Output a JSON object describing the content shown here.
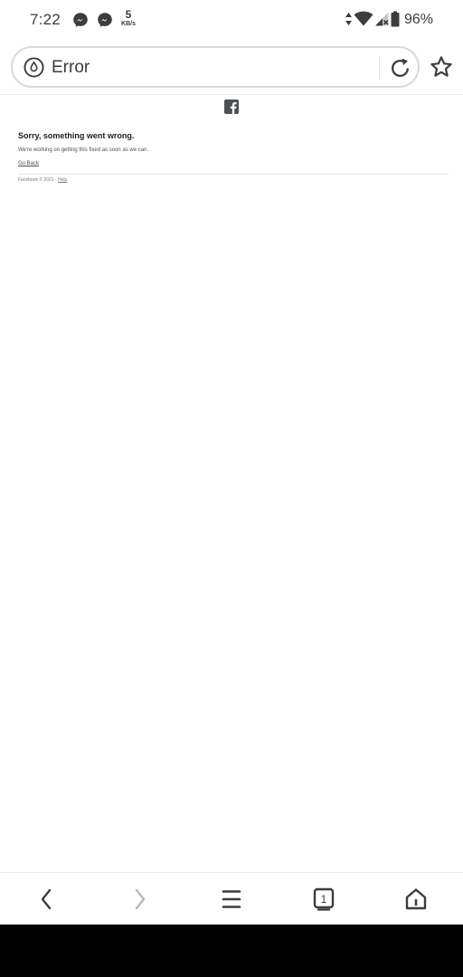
{
  "status_bar": {
    "time": "7:22",
    "net_speed_value": "5",
    "net_speed_unit": "KB/s",
    "battery_percent": "96%"
  },
  "address_bar": {
    "title": "Error"
  },
  "page": {
    "error_title": "Sorry, something went wrong.",
    "error_message": "We're working on getting this fixed as soon as we can.",
    "go_back_link": "Go Back",
    "footer_text": "Facebook © 2021 · ",
    "footer_help_link": "Help"
  },
  "icons": {
    "messenger": "messenger-icon",
    "wifi": "wifi-icon",
    "signal": "signal-icon",
    "battery": "battery-icon",
    "site": "site-info-icon",
    "reload": "reload-icon",
    "bookmark": "star-icon",
    "facebook": "facebook-logo-icon",
    "back": "chevron-left-icon",
    "forward": "chevron-right-icon",
    "menu": "menu-icon",
    "tabs": "tabs-icon",
    "home": "home-icon"
  },
  "colors": {
    "icon_gray": "#3c3c3c",
    "text_primary": "#1c1e21",
    "text_secondary": "#4b4f56",
    "border": "#d9d9d9"
  },
  "tabs": {
    "count": "1"
  }
}
